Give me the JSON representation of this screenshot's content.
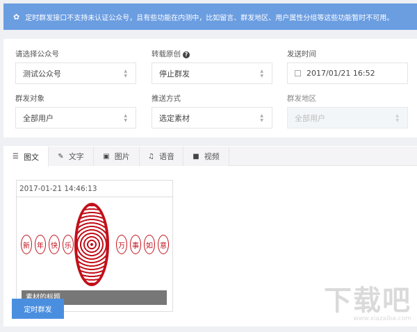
{
  "notice": {
    "icon": "gear-icon",
    "text": "定时群发接口不支持未认证公众号，且有些功能在内测中，比如留言、群发地区、用户属性分组等这些功能暂时不可用。"
  },
  "form": {
    "account": {
      "label": "请选择公众号",
      "value": "测试公众号"
    },
    "reprint": {
      "label": "转载原创",
      "value": "停止群发"
    },
    "send_time": {
      "label": "发送时间",
      "value": "2017/01/21 16:52"
    },
    "target": {
      "label": "群发对象",
      "value": "全部用户"
    },
    "push_mode": {
      "label": "推送方式",
      "value": "选定素材"
    },
    "region": {
      "label": "群发地区",
      "value": "全部用户",
      "disabled": true
    }
  },
  "tabs": [
    {
      "label": "图文",
      "icon": "news-icon",
      "active": true
    },
    {
      "label": "文字",
      "icon": "edit-icon"
    },
    {
      "label": "图片",
      "icon": "image-icon"
    },
    {
      "label": "语音",
      "icon": "music-icon"
    },
    {
      "label": "视频",
      "icon": "video-icon"
    }
  ],
  "material": {
    "date": "2017-01-21 14:46:13",
    "title": "素材的标题",
    "image_text": [
      "新",
      "年",
      "快",
      "乐",
      "万",
      "事",
      "如",
      "意"
    ]
  },
  "submit_label": "定时群发",
  "watermark": {
    "big": "下载吧",
    "small": "www.xiazaiba.com"
  }
}
